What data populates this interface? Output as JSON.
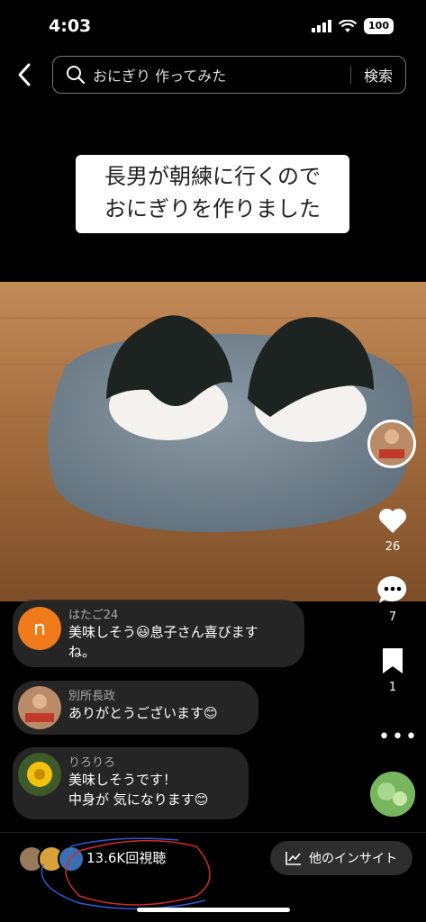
{
  "status_bar": {
    "time": "4:03",
    "battery": "100"
  },
  "search": {
    "query": "おにぎり 作ってみた",
    "button": "検索"
  },
  "caption": {
    "line1": "長男が朝練に行くので",
    "line2": "おにぎりを作りました"
  },
  "rail": {
    "likes": "26",
    "comments": "7",
    "saves": "1"
  },
  "comments": [
    {
      "name": "はたご24",
      "avatar_letter": "n",
      "line1": "美味しそう😃息子さん喜びます",
      "line2": "ね。"
    },
    {
      "name": "別所長政",
      "line1": "ありがとうございます😊"
    },
    {
      "name": "りろりろ",
      "line1": "美味しそうです！",
      "line2": "中身が 気になります😊"
    }
  ],
  "footer": {
    "views": "13.6K回視聴",
    "insight": "他のインサイト"
  },
  "colors": {
    "comment_avatar_orange": "#f07b1a"
  }
}
